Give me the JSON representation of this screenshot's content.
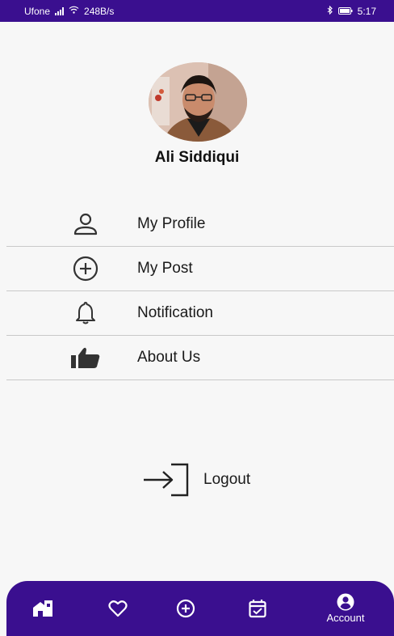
{
  "status_bar": {
    "carrier": "Ufone",
    "network_speed": "248B/s",
    "time": "5:17"
  },
  "profile": {
    "name": "Ali Siddiqui"
  },
  "menu": {
    "items": [
      {
        "label": "My Profile",
        "icon": "person-icon"
      },
      {
        "label": "My Post",
        "icon": "add-circle-icon"
      },
      {
        "label": "Notification",
        "icon": "bell-icon"
      },
      {
        "label": "About Us",
        "icon": "thumbs-up-icon"
      }
    ]
  },
  "logout": {
    "label": "Logout",
    "icon": "logout-icon"
  },
  "bottom_nav": {
    "items": [
      {
        "name": "home",
        "icon": "home-icon",
        "label": ""
      },
      {
        "name": "favorites",
        "icon": "heart-icon",
        "label": ""
      },
      {
        "name": "add",
        "icon": "add-circle-icon",
        "label": ""
      },
      {
        "name": "calendar",
        "icon": "calendar-check-icon",
        "label": ""
      },
      {
        "name": "account",
        "icon": "account-icon",
        "label": "Account",
        "active": true
      }
    ]
  },
  "colors": {
    "primary": "#3a0f8f",
    "background": "#f7f7f7",
    "divider": "#c9c9c9"
  }
}
